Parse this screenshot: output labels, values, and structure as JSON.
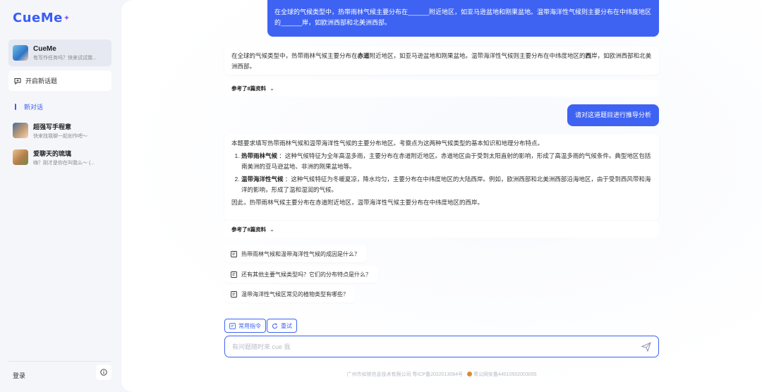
{
  "brand": {
    "name": "CueMe",
    "star": "✦"
  },
  "sidebar": {
    "profile": {
      "name": "CueMe",
      "subtitle": "有写作任务吗？快来试试我..."
    },
    "new_topic_label": "开启新话题",
    "new_chat_label": "新对话",
    "chats": [
      {
        "name": "超强写手程意",
        "subtitle": "快来找我聊一起创作吧～"
      },
      {
        "name": "爱聊天的琉璃",
        "subtitle": "嗨？刚才是你在叫我么～ (..."
      }
    ],
    "login_label": "登录"
  },
  "conversation": {
    "user_msg_1": "在全球的气候类型中，热带雨林气候主要分布在______附近地区，如亚马逊盆地和刚果盆地。温带海洋性气候则主要分布在中纬度地区的______岸，如欧洲西部和北美洲西部。",
    "ai_answer_1": {
      "p1": "在全球的气候类型中，热带雨林气候主要分布在",
      "b1": "赤道",
      "p2": "附近地区，如亚马逊盆地和刚果盆地。温带海洋性气候则主要分布在中纬度地区的",
      "b2": "西",
      "p3": "岸，如欧洲西部和北美洲西部。"
    },
    "ref_label": "参考了8篇资料",
    "user_msg_2": "请对这道题目进行推导分析",
    "ai_answer_2": {
      "intro": "本题要求填写热带雨林气候和温带海洋性气候的主要分布地区。考察点为这两种气候类型的基本知识和地理分布特点。",
      "item1_title": "热带雨林气候",
      "item1_text": "：这种气候特征为全年高温多雨，主要分布在赤道附近地区。赤道地区由于受到太阳直射的影响，形成了高温多雨的气候条件。典型地区包括南美洲的亚马逊盆地、非洲的刚果盆地等。",
      "item2_title": "温带海洋性气候",
      "item2_text": "：这种气候特征为冬暖夏凉，降水均匀，主要分布在中纬度地区的大陆西岸。例如，欧洲西部和北美洲西部沿海地区，由于受到西风带和海洋的影响，形成了温和湿润的气候。",
      "conclusion": "因此，热带雨林气候主要分布在赤道附近地区，温带海洋性气候主要分布在中纬度地区的西岸。"
    },
    "suggestions": [
      "热带雨林气候和温带海洋性气候的成因是什么？",
      "还有其他主要气候类型吗？它们的分布特点是什么？",
      "温带海洋性气候区常见的植物类型有哪些？"
    ]
  },
  "composer": {
    "common_cmd_label": "常用指令",
    "retry_label": "重试",
    "placeholder": "有问题随时来 cue 我"
  },
  "footer": {
    "company": "广州市如铁信息技术有限公司 粤ICP备2022013084号",
    "police": "粤公网安备44010502003055"
  },
  "colors": {
    "accent": "#3e63f3",
    "sidebar_bg": "#f5f6fa"
  }
}
